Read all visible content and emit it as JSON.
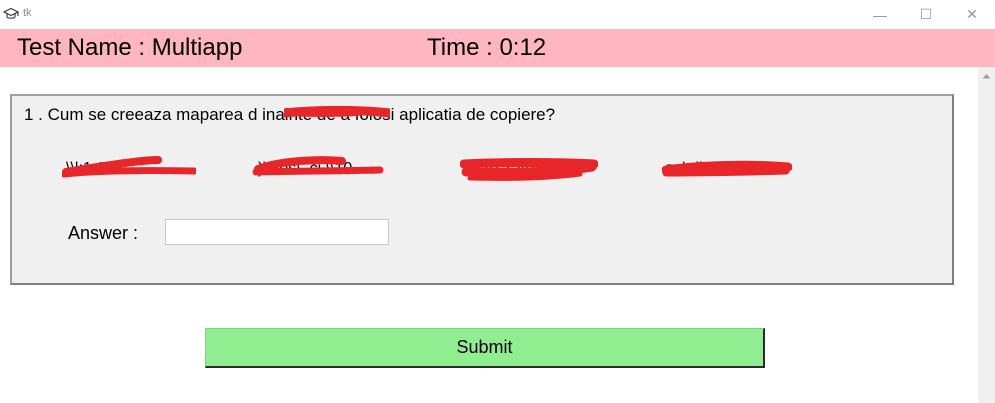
{
  "window": {
    "title": "tk",
    "icon": "graduation-cap-icon",
    "controls": {
      "minimize": "—",
      "maximize": "☐",
      "close": "✕"
    }
  },
  "header": {
    "test_name": "Test Name : Multiapp",
    "time": "Time : 0:12",
    "background": "#ffb6c1"
  },
  "question": {
    "text": "1 . Cum se creeaza maparea d        inainte de a folosi aplicatia de copiere?",
    "options": [
      "\\\\l:1.1",
      ")\\files\\ .ci \\\\10.",
      "s  .20.1.40",
      "z         :\\cli.d"
    ],
    "answer_label": "Answer :",
    "answer_value": ""
  },
  "submit": {
    "label": "Submit",
    "background": "#90ee90"
  },
  "colors": {
    "redaction": "#e8262a",
    "frame_background": "#f0f0f0"
  }
}
